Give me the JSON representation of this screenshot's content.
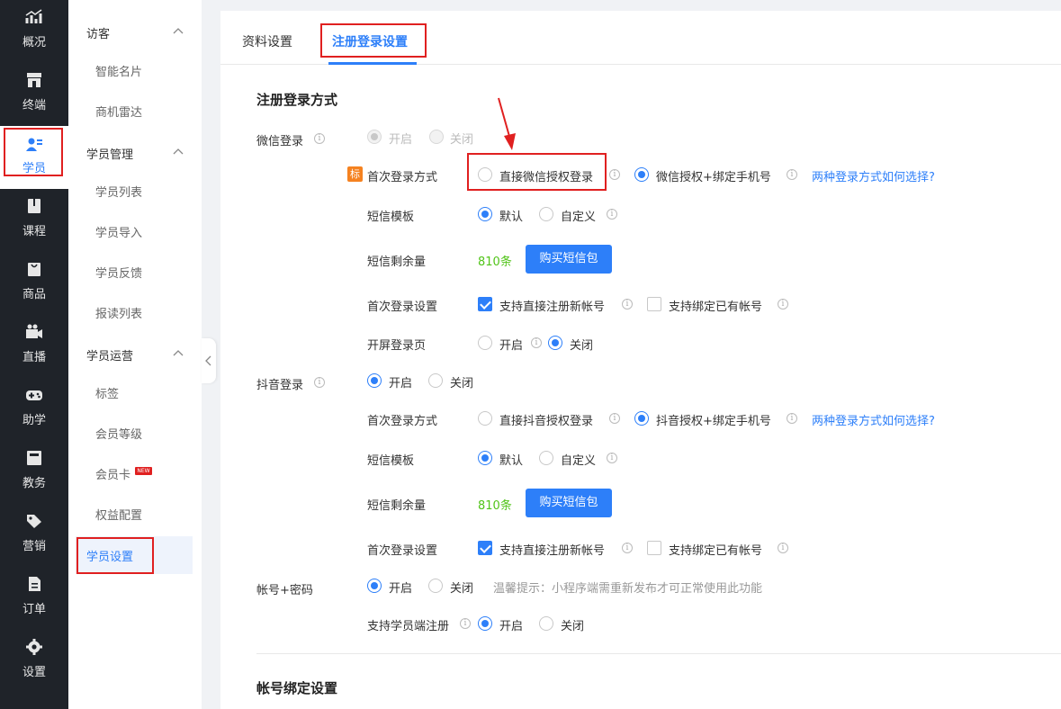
{
  "rail": [
    {
      "label": "概况",
      "icon": "chart-up-icon"
    },
    {
      "label": "终端",
      "icon": "store-icon"
    },
    {
      "label": "学员",
      "icon": "users-icon"
    },
    {
      "label": "课程",
      "icon": "book-icon"
    },
    {
      "label": "商品",
      "icon": "bag-icon"
    },
    {
      "label": "直播",
      "icon": "video-icon"
    },
    {
      "label": "助学",
      "icon": "gamepad-icon"
    },
    {
      "label": "教务",
      "icon": "calendar-icon"
    },
    {
      "label": "营销",
      "icon": "tag-icon"
    },
    {
      "label": "订单",
      "icon": "document-icon"
    },
    {
      "label": "设置",
      "icon": "gear-icon"
    }
  ],
  "submenu": {
    "groups": [
      {
        "title": "访客",
        "items": [
          "智能名片",
          "商机雷达"
        ]
      },
      {
        "title": "学员管理",
        "items": [
          "学员列表",
          "学员导入",
          "学员反馈",
          "报读列表"
        ]
      },
      {
        "title": "学员运营",
        "items": [
          "标签",
          "会员等级",
          "会员卡",
          "权益配置",
          "学员设置"
        ]
      }
    ],
    "new_badge": "NEW"
  },
  "tabs": [
    "资料设置",
    "注册登录设置"
  ],
  "section1": {
    "title": "注册登录方式",
    "wechat": {
      "label": "微信登录",
      "on": "开启",
      "off": "关闭",
      "tag": "标",
      "first_login_label": "首次登录方式",
      "first_opt1": "直接微信授权登录",
      "first_opt2": "微信授权+绑定手机号",
      "help_link": "两种登录方式如何选择?",
      "sms_tpl_label": "短信模板",
      "sms_default": "默认",
      "sms_custom": "自定义",
      "sms_left_label": "短信剩余量",
      "sms_left_value": "810条",
      "buy_btn": "购买短信包",
      "first_setting_label": "首次登录设置",
      "cb1": "支持直接注册新帐号",
      "cb2": "支持绑定已有帐号",
      "splash_label": "开屏登录页",
      "splash_on": "开启",
      "splash_off": "关闭"
    },
    "douyin": {
      "label": "抖音登录",
      "on": "开启",
      "off": "关闭",
      "first_login_label": "首次登录方式",
      "first_opt1": "直接抖音授权登录",
      "first_opt2": "抖音授权+绑定手机号",
      "help_link": "两种登录方式如何选择?",
      "sms_tpl_label": "短信模板",
      "sms_default": "默认",
      "sms_custom": "自定义",
      "sms_left_label": "短信剩余量",
      "sms_left_value": "810条",
      "buy_btn": "购买短信包",
      "first_setting_label": "首次登录设置",
      "cb1": "支持直接注册新帐号",
      "cb2": "支持绑定已有帐号"
    },
    "account": {
      "label": "帐号+密码",
      "on": "开启",
      "off": "关闭",
      "hint": "温馨提示：小程序端需重新发布才可正常使用此功能",
      "register_label": "支持学员端注册",
      "reg_on": "开启",
      "reg_off": "关闭"
    }
  },
  "section2": {
    "title": "帐号绑定设置"
  },
  "colors": {
    "accent": "#2d7ff9",
    "highlight": "#e02020",
    "success": "#52c41a",
    "tag": "#f58220",
    "rail_bg": "#1f2329"
  }
}
